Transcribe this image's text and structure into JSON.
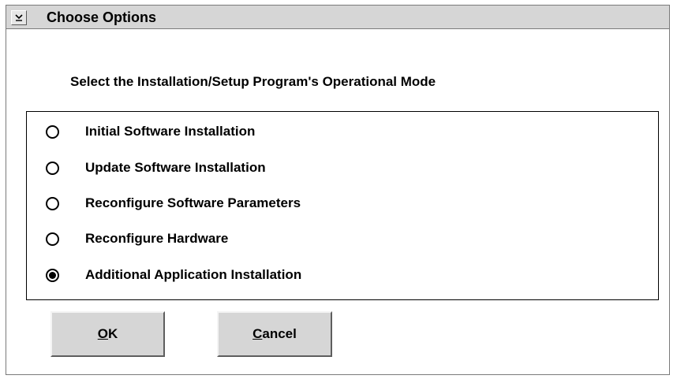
{
  "window": {
    "title": "Choose Options",
    "system_menu_icon": "chevron-down-icon"
  },
  "heading": "Select the Installation/Setup Program's Operational Mode",
  "options": [
    {
      "label": "Initial Software Installation",
      "selected": false
    },
    {
      "label": "Update Software Installation",
      "selected": false
    },
    {
      "label": "Reconfigure Software Parameters",
      "selected": false
    },
    {
      "label": "Reconfigure Hardware",
      "selected": false
    },
    {
      "label": "Additional Application Installation",
      "selected": true
    }
  ],
  "buttons": {
    "ok_label": "OK",
    "cancel_label": "Cancel"
  },
  "colors": {
    "titlebar": "#d6d6d6",
    "button_face": "#d6d6d6",
    "background": "#ffffff"
  }
}
